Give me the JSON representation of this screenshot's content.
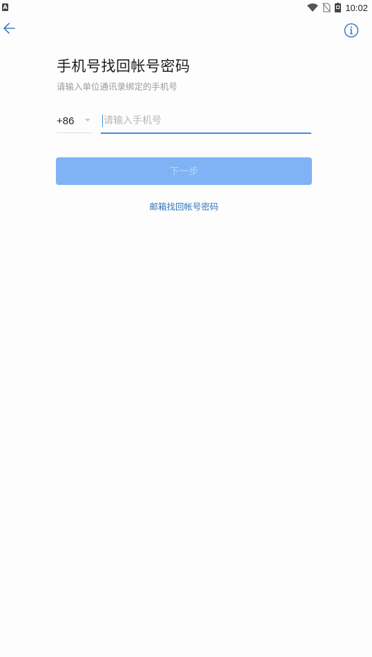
{
  "status_bar": {
    "left_icon_letter": "A",
    "time": "10:02",
    "icons": [
      "wifi-icon",
      "no-sim-icon",
      "battery-icon"
    ]
  },
  "nav": {
    "back_icon": "arrow-left-icon",
    "info_icon": "info-icon"
  },
  "header": {
    "title": "手机号找回帐号密码",
    "subtitle": "请输入单位通讯录绑定的手机号"
  },
  "form": {
    "country_code": "+86",
    "phone_value": "",
    "phone_placeholder": "请输入手机号",
    "next_label": "下一步"
  },
  "links": {
    "email_recovery": "邮箱找回帐号密码"
  },
  "colors": {
    "accent": "#3d8ee0",
    "button_disabled_bg": "#7fb3f5",
    "link": "#3576b8"
  }
}
